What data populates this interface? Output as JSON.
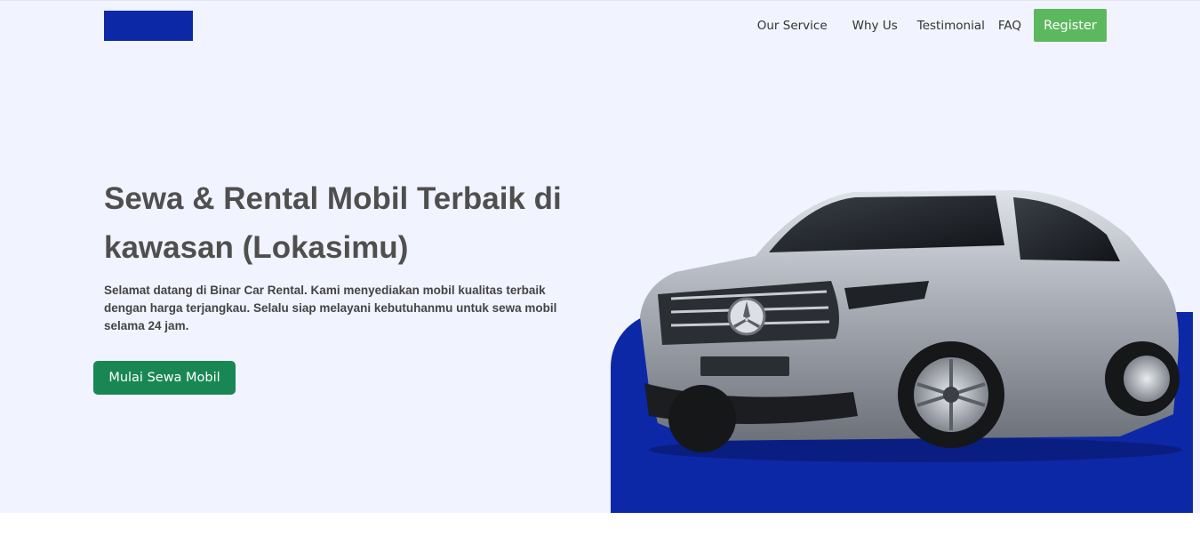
{
  "header": {
    "nav": {
      "our_service": "Our Service",
      "why_us": "Why Us",
      "testimonial": "Testimonial",
      "faq": "FAQ"
    },
    "register_label": "Register"
  },
  "hero": {
    "title": "Sewa & Rental Mobil Terbaik di kawasan (Lokasimu)",
    "description": "Selamat datang di Binar Car Rental. Kami menyediakan mobil kualitas terbaik dengan harga terjangkau. Selalu siap melayani kebutuhanmu untuk sewa mobil selama 24 jam.",
    "cta_label": "Mulai Sewa Mobil"
  },
  "colors": {
    "brand_blue": "#0d28a6",
    "hero_background": "#f1f3fe",
    "register_green": "#5cb85f",
    "cta_green": "#198754",
    "text_dark": "#4f4f4f"
  }
}
